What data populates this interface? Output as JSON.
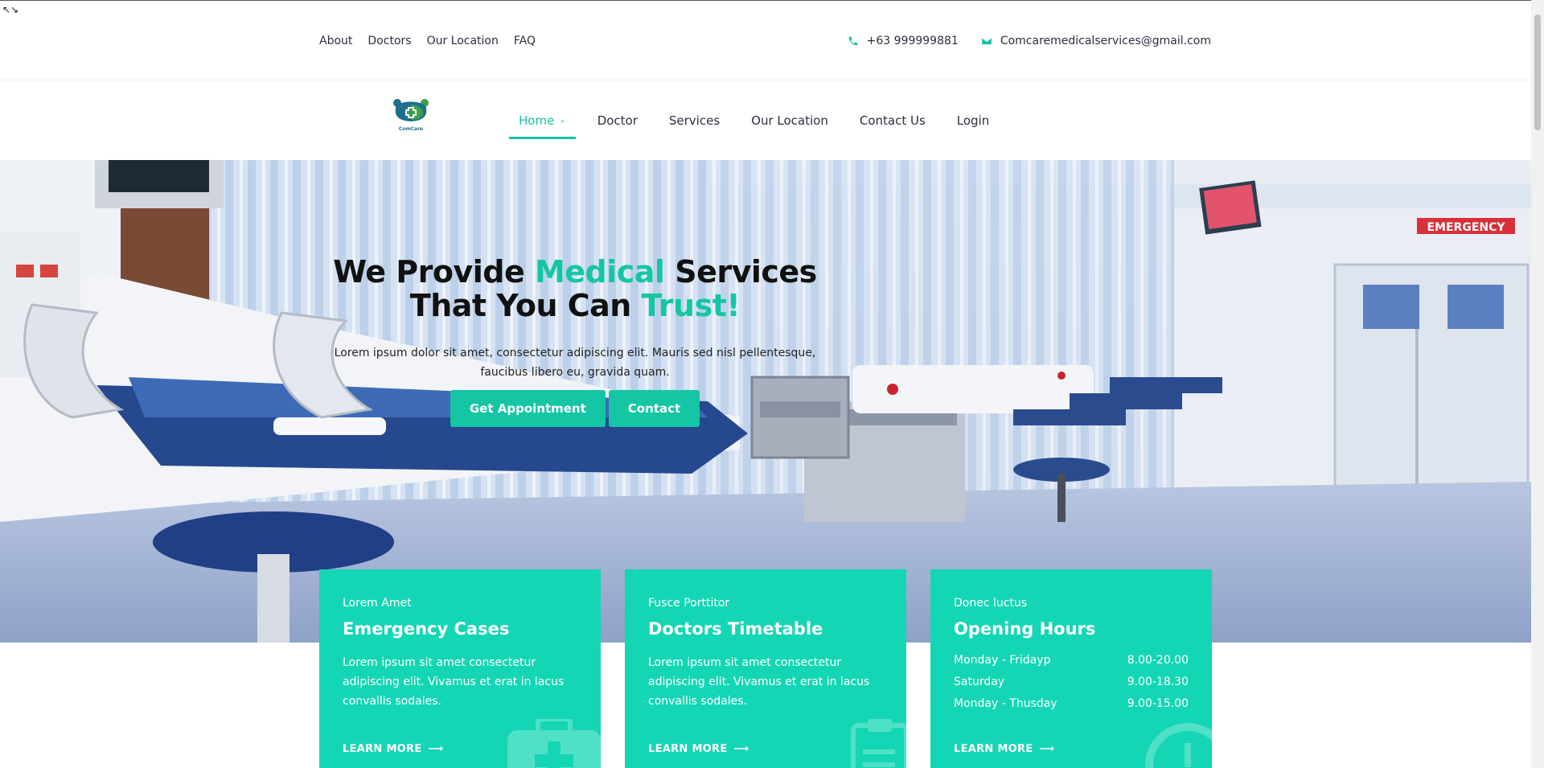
{
  "topbar": {
    "links": [
      "About",
      "Doctors",
      "Our Location",
      "FAQ"
    ],
    "phone": "+63 999999881",
    "email": "Comcaremedicalservices@gmail.com"
  },
  "nav": {
    "logo_text": "ComCare",
    "items": [
      {
        "label": "Home",
        "active": true
      },
      {
        "label": "Doctor"
      },
      {
        "label": "Services"
      },
      {
        "label": "Our Location"
      },
      {
        "label": "Contact Us"
      },
      {
        "label": "Login"
      }
    ]
  },
  "hero": {
    "title_1a": "We Provide ",
    "title_1b": "Medical",
    "title_1c": " Services",
    "title_2a": "That You Can ",
    "title_2b": "Trust!",
    "subtitle": "Lorem ipsum dolor sit amet, consectetur adipiscing elit. Mauris sed nisl pellentesque, faucibus libero eu, gravida quam.",
    "btn_appointment": "Get Appointment",
    "btn_contact": "Contact",
    "sign_text": "EMERGENCY"
  },
  "cards": [
    {
      "kicker": "Lorem Amet",
      "title": "Emergency Cases",
      "desc": "Lorem ipsum sit amet consectetur adipiscing elit. Vivamus et erat in lacus convallis sodales.",
      "link": "LEARN MORE"
    },
    {
      "kicker": "Fusce Porttitor",
      "title": "Doctors Timetable",
      "desc": "Lorem ipsum sit amet consectetur adipiscing elit. Vivamus et erat in lacus convallis sodales.",
      "link": "LEARN MORE"
    },
    {
      "kicker": "Donec luctus",
      "title": "Opening Hours",
      "hours": [
        {
          "day": "Monday - Fridayp",
          "time": "8.00-20.00"
        },
        {
          "day": "Saturday",
          "time": "9.00-18.30"
        },
        {
          "day": "Monday - Thusday",
          "time": "9.00-15.00"
        }
      ],
      "link": "LEARN MORE"
    }
  ],
  "colors": {
    "accent": "#14c6a3",
    "card": "#14d6b4",
    "text": "#2c2d3f"
  },
  "icons": [
    "phone-icon",
    "mail-icon",
    "chevron-down-icon",
    "arrow-right-icon",
    "medical-kit-icon",
    "clipboard-icon",
    "clock-icon"
  ]
}
